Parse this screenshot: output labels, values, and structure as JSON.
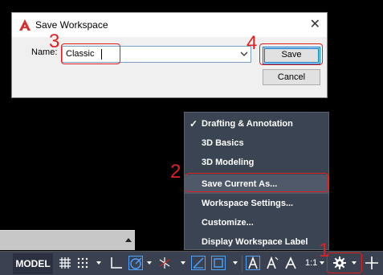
{
  "dialog": {
    "title": "Save Workspace",
    "name_label": "Name:",
    "name_value": "Classic",
    "save_label": "Save",
    "cancel_label": "Cancel",
    "close_symbol": "✕"
  },
  "menu": {
    "items": [
      {
        "label": "Drafting & Annotation",
        "checked": true
      },
      {
        "label": "3D Basics"
      },
      {
        "label": "3D Modeling"
      },
      {
        "label": "Save Current As..."
      },
      {
        "label": "Workspace Settings..."
      },
      {
        "label": "Customize..."
      },
      {
        "label": "Display Workspace Label"
      }
    ],
    "check_symbol": "✓"
  },
  "statusbar": {
    "model_label": "MODEL",
    "scale_label": "1:1"
  },
  "annotations": {
    "n1": "1",
    "n2": "2",
    "n3": "3",
    "n4": "4"
  },
  "colors": {
    "annotation": "#e02020",
    "menu_bg": "#3b4453",
    "statusbar_bg": "#3a4150",
    "accent": "#0078d7"
  }
}
